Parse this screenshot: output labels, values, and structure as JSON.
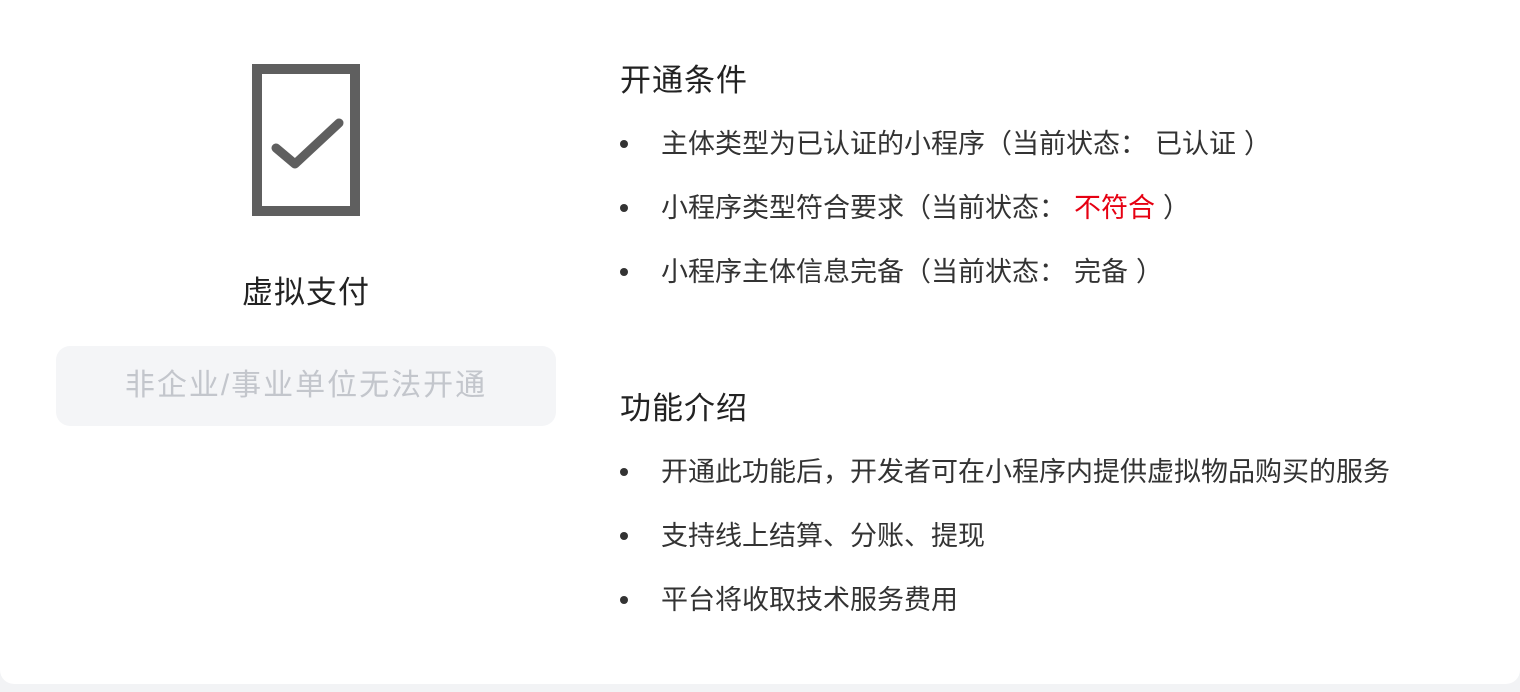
{
  "feature": {
    "icon": "phone-check-icon",
    "name": "虚拟支付",
    "button_label": "非企业/事业单位无法开通",
    "button_disabled": true
  },
  "requirements": {
    "title": "开通条件",
    "items": [
      {
        "label": "主体类型为已认证的小程序（当前状态：",
        "status": "已认证",
        "suffix": "）",
        "met": true
      },
      {
        "label": "小程序类型符合要求（当前状态：",
        "status": "不符合",
        "suffix": "）",
        "met": false
      },
      {
        "label": "小程序主体信息完备（当前状态：",
        "status": "完备",
        "suffix": "）",
        "met": true
      }
    ]
  },
  "introduction": {
    "title": "功能介绍",
    "items": [
      "开通此功能后，开发者可在小程序内提供虚拟物品购买的服务",
      "支持线上结算、分账、提现",
      "平台将收取技术服务费用"
    ]
  },
  "colors": {
    "unmet_status": "#e60012",
    "icon_gray": "#5f5f5f",
    "disabled_text": "#c3c6cc",
    "disabled_bg": "#f4f5f7"
  }
}
